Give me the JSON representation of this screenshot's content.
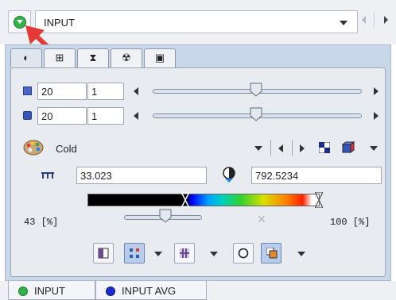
{
  "header": {
    "selector_value": "INPUT"
  },
  "tabs": [
    {
      "icon": "contrast-icon",
      "glyph": "◐"
    },
    {
      "icon": "grid-icon",
      "glyph": "⊞"
    },
    {
      "icon": "hourglass-icon",
      "glyph": "⧗"
    },
    {
      "icon": "radiation-icon",
      "glyph": "☢"
    },
    {
      "icon": "save-icon",
      "glyph": "▣"
    }
  ],
  "slice_controls": {
    "row1": {
      "value1": "20",
      "value2": "1",
      "slider_fraction": 0.5
    },
    "row2": {
      "value1": "20",
      "value2": "1",
      "slider_fraction": 0.5
    }
  },
  "lut": {
    "name": "Cold",
    "min_value": "33.023",
    "max_value": "792.5234",
    "lower_percent": "43 [%]",
    "upper_percent": "100 [%]",
    "lower_slider_fraction": 0.43
  },
  "bottom_tabs": [
    {
      "label": "INPUT",
      "color": "#33b24a"
    },
    {
      "label": "INPUT AVG",
      "color": "#1c2bd0"
    }
  ],
  "colors": {
    "panel_bg": "#c9d7eb",
    "accent_green": "#33b24a",
    "annotation_arrow": "#e53935"
  }
}
